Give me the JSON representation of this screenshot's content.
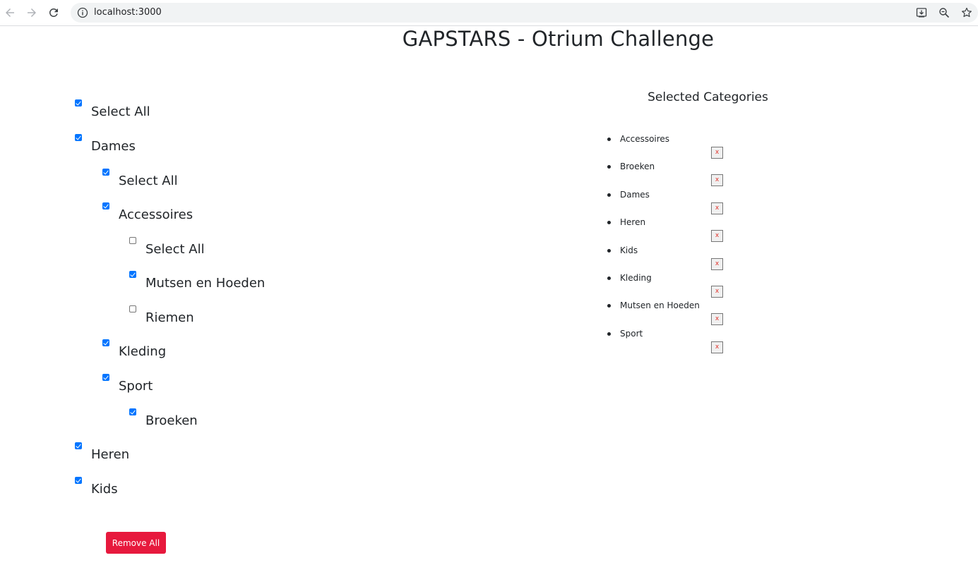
{
  "browser": {
    "url": "localhost:3000",
    "icons": [
      "back-icon",
      "forward-icon",
      "reload-icon",
      "info-icon",
      "install-icon",
      "zoom-icon",
      "bookmark-star-icon"
    ]
  },
  "page": {
    "title": "GAPSTARS - Otrium Challenge"
  },
  "tree": [
    {
      "label": "Select All",
      "checked": true,
      "level": 0
    },
    {
      "label": "Dames",
      "checked": true,
      "level": 0
    },
    {
      "label": "Select All",
      "checked": true,
      "level": 1
    },
    {
      "label": "Accessoires",
      "checked": true,
      "level": 1
    },
    {
      "label": "Select All",
      "checked": false,
      "level": 2
    },
    {
      "label": "Mutsen en Hoeden",
      "checked": true,
      "level": 2
    },
    {
      "label": "Riemen",
      "checked": false,
      "level": 2
    },
    {
      "label": "Kleding",
      "checked": true,
      "level": 1
    },
    {
      "label": "Sport",
      "checked": true,
      "level": 1
    },
    {
      "label": "Broeken",
      "checked": true,
      "level": 2
    },
    {
      "label": "Heren",
      "checked": true,
      "level": 0
    },
    {
      "label": "Kids",
      "checked": true,
      "level": 0
    }
  ],
  "selected": {
    "heading": "Selected Categories",
    "remove_label": "x",
    "items": [
      "Accessoires",
      "Broeken",
      "Dames",
      "Heren",
      "Kids",
      "Kleding",
      "Mutsen en Hoeden",
      "Sport"
    ]
  },
  "actions": {
    "remove_all_label": "Remove All",
    "remove_all_color": "#e7193d",
    "checkbox_color": "#0075ff"
  }
}
